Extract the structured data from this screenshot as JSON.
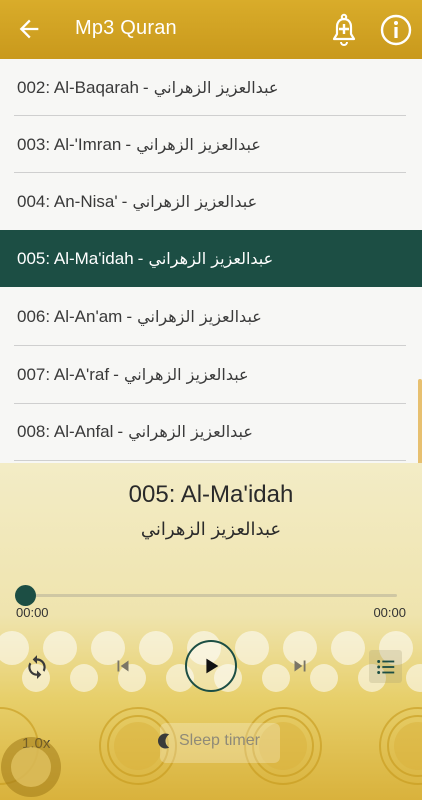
{
  "appbar": {
    "title": "Mp3 Quran",
    "icons": [
      "arrow-back-icon",
      "alarm-add-icon",
      "info-icon"
    ]
  },
  "list": {
    "items": [
      {
        "name": "002: Al-Baqarah",
        "reciter": "- عبدالعزيز الزهراني"
      },
      {
        "name": "003: Al-'Imran",
        "reciter": "- عبدالعزيز الزهراني"
      },
      {
        "name": "004: An-Nisa'",
        "reciter": "- عبدالعزيز الزهراني"
      },
      {
        "name": "005: Al-Ma'idah",
        "reciter": "- عبدالعزيز الزهراني",
        "selected": true
      },
      {
        "name": "006: Al-An'am",
        "reciter": "- عبدالعزيز الزهراني"
      },
      {
        "name": "007: Al-A'raf",
        "reciter": "- عبدالعزيز الزهراني"
      },
      {
        "name": "008: Al-Anfal",
        "reciter": "- عبدالعزيز الزهراني"
      }
    ]
  },
  "player": {
    "title": "005: Al-Ma'idah",
    "reciter": "عبدالعزيز الزهراني",
    "elapsed": "00:00",
    "duration": "00:00",
    "progress": 0,
    "speed": "1.0x",
    "sleep_label": "Sleep timer"
  },
  "colors": {
    "appbar": "#d4a626",
    "selected_row": "#1c4e44",
    "accent": "#1c4e44"
  }
}
